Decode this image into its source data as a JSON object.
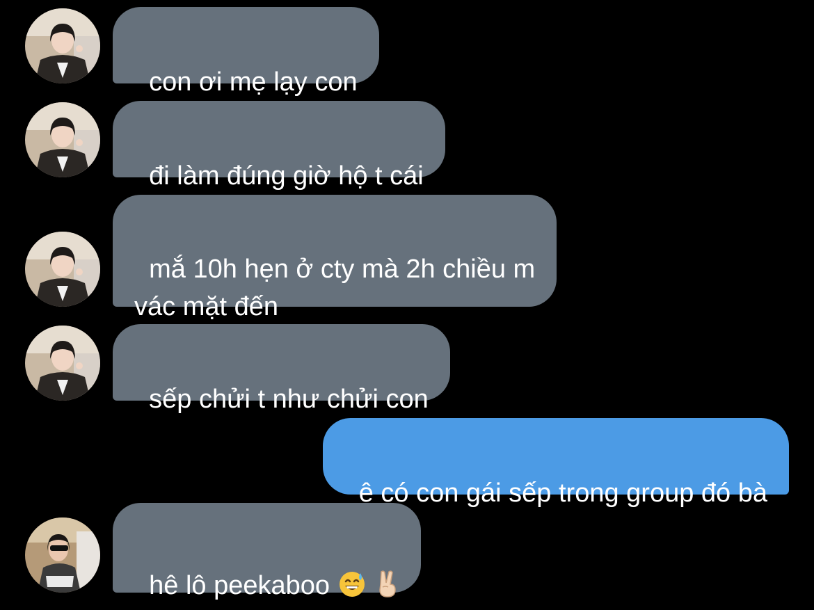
{
  "conversation": {
    "messages": [
      {
        "sender": "other",
        "avatar": "avatar-1",
        "text": "con ơi mẹ lạy con"
      },
      {
        "sender": "other",
        "avatar": "avatar-1",
        "text": "đi làm đúng giờ hộ t cái"
      },
      {
        "sender": "other",
        "avatar": "avatar-1",
        "text": "mắ 10h hẹn ở cty mà 2h chiều m\nvác mặt đến"
      },
      {
        "sender": "other",
        "avatar": "avatar-1",
        "text": "sếp chửi t như chửi con"
      },
      {
        "sender": "me",
        "text": "ê có con gái sếp trong group đó bà"
      },
      {
        "sender": "other",
        "avatar": "avatar-2",
        "text": "hê lô peekaboo",
        "emojis": [
          "sweat-smile-emoji",
          "victory-hand-emoji"
        ]
      }
    ]
  },
  "colors": {
    "background": "#000000",
    "incoming_bubble": "#66717c",
    "outgoing_bubble": "#4c9be5",
    "text": "#ffffff"
  }
}
